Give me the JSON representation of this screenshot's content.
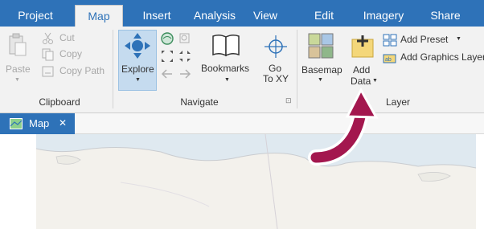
{
  "tabs": [
    "Project",
    "Map",
    "Insert",
    "Analysis",
    "View",
    "Edit",
    "Imagery",
    "Share"
  ],
  "active_tab": "Map",
  "clipboard": {
    "paste": "Paste",
    "cut": "Cut",
    "copy": "Copy",
    "copy_path": "Copy Path",
    "group_label": "Clipboard"
  },
  "navigate": {
    "explore": "Explore",
    "bookmarks": "Bookmarks",
    "go_to_xy_line1": "Go",
    "go_to_xy_line2": "To XY",
    "group_label": "Navigate"
  },
  "layer": {
    "basemap": "Basemap",
    "add_data_line1": "Add",
    "add_data_line2": "Data",
    "add_preset": "Add Preset",
    "add_graphics_layer": "Add Graphics Layer",
    "group_label": "Layer"
  },
  "view_tab": {
    "label": "Map",
    "close": "✕"
  },
  "colors": {
    "accent": "#2e72b8",
    "annotation_arrow": "#a3174e",
    "map_land": "#f3f1ec",
    "map_water": "#dfe9f0"
  }
}
